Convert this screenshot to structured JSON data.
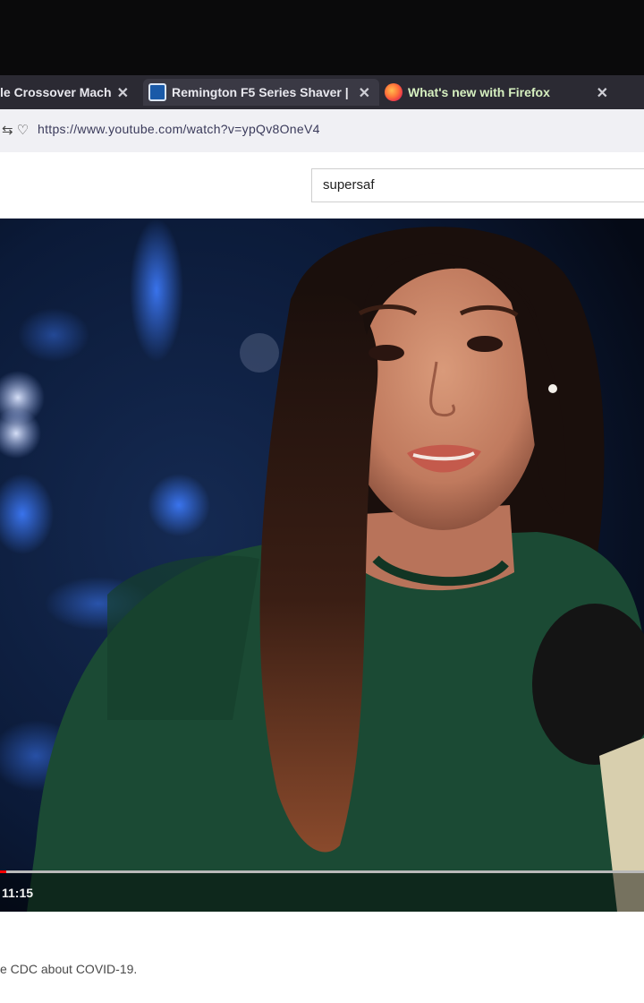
{
  "tabs": [
    {
      "label": "le Crossover Mach",
      "close": "✕"
    },
    {
      "label": "Remington F5 Series Shaver |",
      "close": "✕",
      "icon": "site-favicon"
    },
    {
      "label": "What's new with Firefox",
      "close": "✕",
      "icon": "firefox-icon"
    }
  ],
  "address_bar": {
    "url": "https://www.youtube.com/watch?v=ypQv8OneV4",
    "icons": "⇆ ♡"
  },
  "search": {
    "value": "supersaf"
  },
  "player": {
    "current_time": "11:15",
    "progress": 0.01
  },
  "description": {
    "text": "e CDC about COVID-19."
  },
  "colors": {
    "tab_bar": "#2b2a33",
    "url_bar": "#f0f0f4",
    "progress_red": "#ff0000",
    "sweater_green": "#1b4a34"
  }
}
